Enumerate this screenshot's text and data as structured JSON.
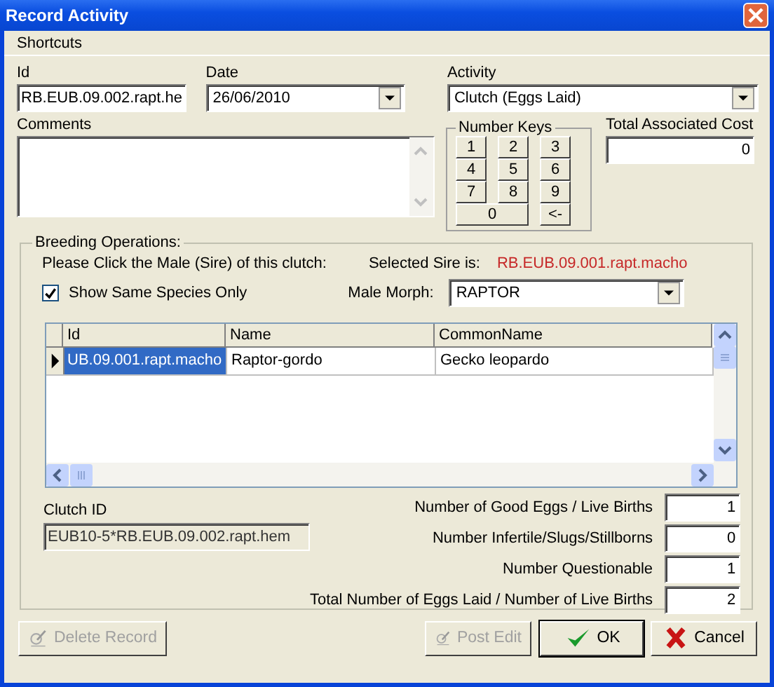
{
  "window": {
    "title": "Record Activity"
  },
  "menu": [
    "Shortcuts"
  ],
  "id": {
    "label": "Id",
    "value": "RB.EUB.09.002.rapt.he"
  },
  "date": {
    "label": "Date",
    "value": "26/06/2010"
  },
  "activity": {
    "label": "Activity",
    "value": "Clutch (Eggs Laid)"
  },
  "comments": {
    "label": "Comments"
  },
  "number_keys": {
    "title": "Number Keys",
    "keys": [
      "1",
      "2",
      "3",
      "4",
      "5",
      "6",
      "7",
      "8",
      "9",
      "0",
      "<-"
    ]
  },
  "total_cost": {
    "label": "Total Associated Cost",
    "value": "0"
  },
  "breeding": {
    "title": "Breeding Operations:",
    "instruction": "Please Click the Male (Sire) of this clutch:",
    "sire_label": "Selected Sire is:",
    "sire_value": "RB.EUB.09.001.rapt.macho",
    "same_species": {
      "label": "Show Same Species Only",
      "checked": true
    },
    "morph": {
      "label": "Male Morph:",
      "value": "RAPTOR"
    },
    "table": {
      "columns": [
        "Id",
        "Name",
        "CommonName"
      ],
      "rows": [
        {
          "cells": [
            "UB.09.001.rapt.macho",
            "Raptor-gordo",
            "Gecko leopardo"
          ],
          "selected": true
        }
      ]
    },
    "clutch_id": {
      "label": "Clutch ID",
      "value": "EUB10-5*RB.EUB.09.002.rapt.hem",
      "disabled": true
    },
    "counts": [
      {
        "label": "Number of Good Eggs / Live Births",
        "value": "1"
      },
      {
        "label": "Number Infertile/Slugs/Stillborns",
        "value": "0"
      },
      {
        "label": "Number Questionable",
        "value": "1"
      },
      {
        "label": "Total Number of Eggs Laid / Number of Live Births",
        "value": "2"
      }
    ]
  },
  "buttons": [
    {
      "label": "Delete Record",
      "kind": "edit",
      "disabled": true
    },
    {
      "label": "Post Edit",
      "kind": "edit",
      "disabled": true
    },
    {
      "label": "OK",
      "kind": "ok",
      "disabled": false
    },
    {
      "label": "Cancel",
      "kind": "cancel",
      "disabled": false
    }
  ]
}
